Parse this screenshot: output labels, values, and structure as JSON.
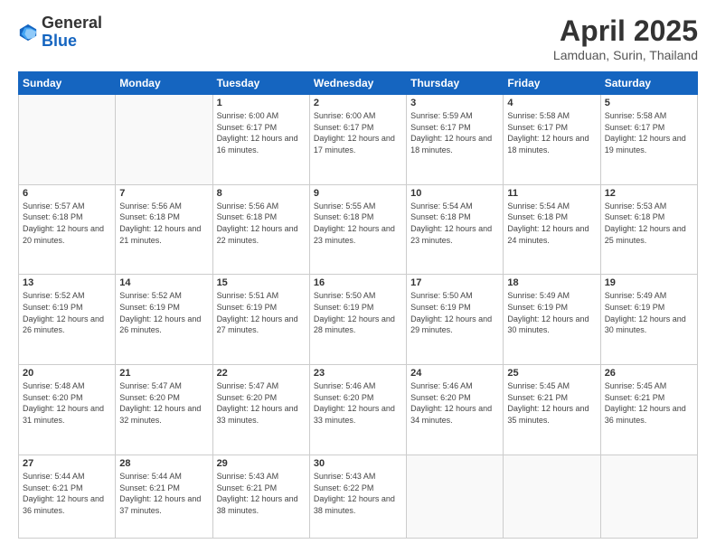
{
  "logo": {
    "general": "General",
    "blue": "Blue"
  },
  "header": {
    "month": "April 2025",
    "location": "Lamduan, Surin, Thailand"
  },
  "days_of_week": [
    "Sunday",
    "Monday",
    "Tuesday",
    "Wednesday",
    "Thursday",
    "Friday",
    "Saturday"
  ],
  "weeks": [
    [
      {
        "day": "",
        "info": ""
      },
      {
        "day": "",
        "info": ""
      },
      {
        "day": "1",
        "info": "Sunrise: 6:00 AM\nSunset: 6:17 PM\nDaylight: 12 hours and 16 minutes."
      },
      {
        "day": "2",
        "info": "Sunrise: 6:00 AM\nSunset: 6:17 PM\nDaylight: 12 hours and 17 minutes."
      },
      {
        "day": "3",
        "info": "Sunrise: 5:59 AM\nSunset: 6:17 PM\nDaylight: 12 hours and 18 minutes."
      },
      {
        "day": "4",
        "info": "Sunrise: 5:58 AM\nSunset: 6:17 PM\nDaylight: 12 hours and 18 minutes."
      },
      {
        "day": "5",
        "info": "Sunrise: 5:58 AM\nSunset: 6:17 PM\nDaylight: 12 hours and 19 minutes."
      }
    ],
    [
      {
        "day": "6",
        "info": "Sunrise: 5:57 AM\nSunset: 6:18 PM\nDaylight: 12 hours and 20 minutes."
      },
      {
        "day": "7",
        "info": "Sunrise: 5:56 AM\nSunset: 6:18 PM\nDaylight: 12 hours and 21 minutes."
      },
      {
        "day": "8",
        "info": "Sunrise: 5:56 AM\nSunset: 6:18 PM\nDaylight: 12 hours and 22 minutes."
      },
      {
        "day": "9",
        "info": "Sunrise: 5:55 AM\nSunset: 6:18 PM\nDaylight: 12 hours and 23 minutes."
      },
      {
        "day": "10",
        "info": "Sunrise: 5:54 AM\nSunset: 6:18 PM\nDaylight: 12 hours and 23 minutes."
      },
      {
        "day": "11",
        "info": "Sunrise: 5:54 AM\nSunset: 6:18 PM\nDaylight: 12 hours and 24 minutes."
      },
      {
        "day": "12",
        "info": "Sunrise: 5:53 AM\nSunset: 6:18 PM\nDaylight: 12 hours and 25 minutes."
      }
    ],
    [
      {
        "day": "13",
        "info": "Sunrise: 5:52 AM\nSunset: 6:19 PM\nDaylight: 12 hours and 26 minutes."
      },
      {
        "day": "14",
        "info": "Sunrise: 5:52 AM\nSunset: 6:19 PM\nDaylight: 12 hours and 26 minutes."
      },
      {
        "day": "15",
        "info": "Sunrise: 5:51 AM\nSunset: 6:19 PM\nDaylight: 12 hours and 27 minutes."
      },
      {
        "day": "16",
        "info": "Sunrise: 5:50 AM\nSunset: 6:19 PM\nDaylight: 12 hours and 28 minutes."
      },
      {
        "day": "17",
        "info": "Sunrise: 5:50 AM\nSunset: 6:19 PM\nDaylight: 12 hours and 29 minutes."
      },
      {
        "day": "18",
        "info": "Sunrise: 5:49 AM\nSunset: 6:19 PM\nDaylight: 12 hours and 30 minutes."
      },
      {
        "day": "19",
        "info": "Sunrise: 5:49 AM\nSunset: 6:19 PM\nDaylight: 12 hours and 30 minutes."
      }
    ],
    [
      {
        "day": "20",
        "info": "Sunrise: 5:48 AM\nSunset: 6:20 PM\nDaylight: 12 hours and 31 minutes."
      },
      {
        "day": "21",
        "info": "Sunrise: 5:47 AM\nSunset: 6:20 PM\nDaylight: 12 hours and 32 minutes."
      },
      {
        "day": "22",
        "info": "Sunrise: 5:47 AM\nSunset: 6:20 PM\nDaylight: 12 hours and 33 minutes."
      },
      {
        "day": "23",
        "info": "Sunrise: 5:46 AM\nSunset: 6:20 PM\nDaylight: 12 hours and 33 minutes."
      },
      {
        "day": "24",
        "info": "Sunrise: 5:46 AM\nSunset: 6:20 PM\nDaylight: 12 hours and 34 minutes."
      },
      {
        "day": "25",
        "info": "Sunrise: 5:45 AM\nSunset: 6:21 PM\nDaylight: 12 hours and 35 minutes."
      },
      {
        "day": "26",
        "info": "Sunrise: 5:45 AM\nSunset: 6:21 PM\nDaylight: 12 hours and 36 minutes."
      }
    ],
    [
      {
        "day": "27",
        "info": "Sunrise: 5:44 AM\nSunset: 6:21 PM\nDaylight: 12 hours and 36 minutes."
      },
      {
        "day": "28",
        "info": "Sunrise: 5:44 AM\nSunset: 6:21 PM\nDaylight: 12 hours and 37 minutes."
      },
      {
        "day": "29",
        "info": "Sunrise: 5:43 AM\nSunset: 6:21 PM\nDaylight: 12 hours and 38 minutes."
      },
      {
        "day": "30",
        "info": "Sunrise: 5:43 AM\nSunset: 6:22 PM\nDaylight: 12 hours and 38 minutes."
      },
      {
        "day": "",
        "info": ""
      },
      {
        "day": "",
        "info": ""
      },
      {
        "day": "",
        "info": ""
      }
    ]
  ]
}
